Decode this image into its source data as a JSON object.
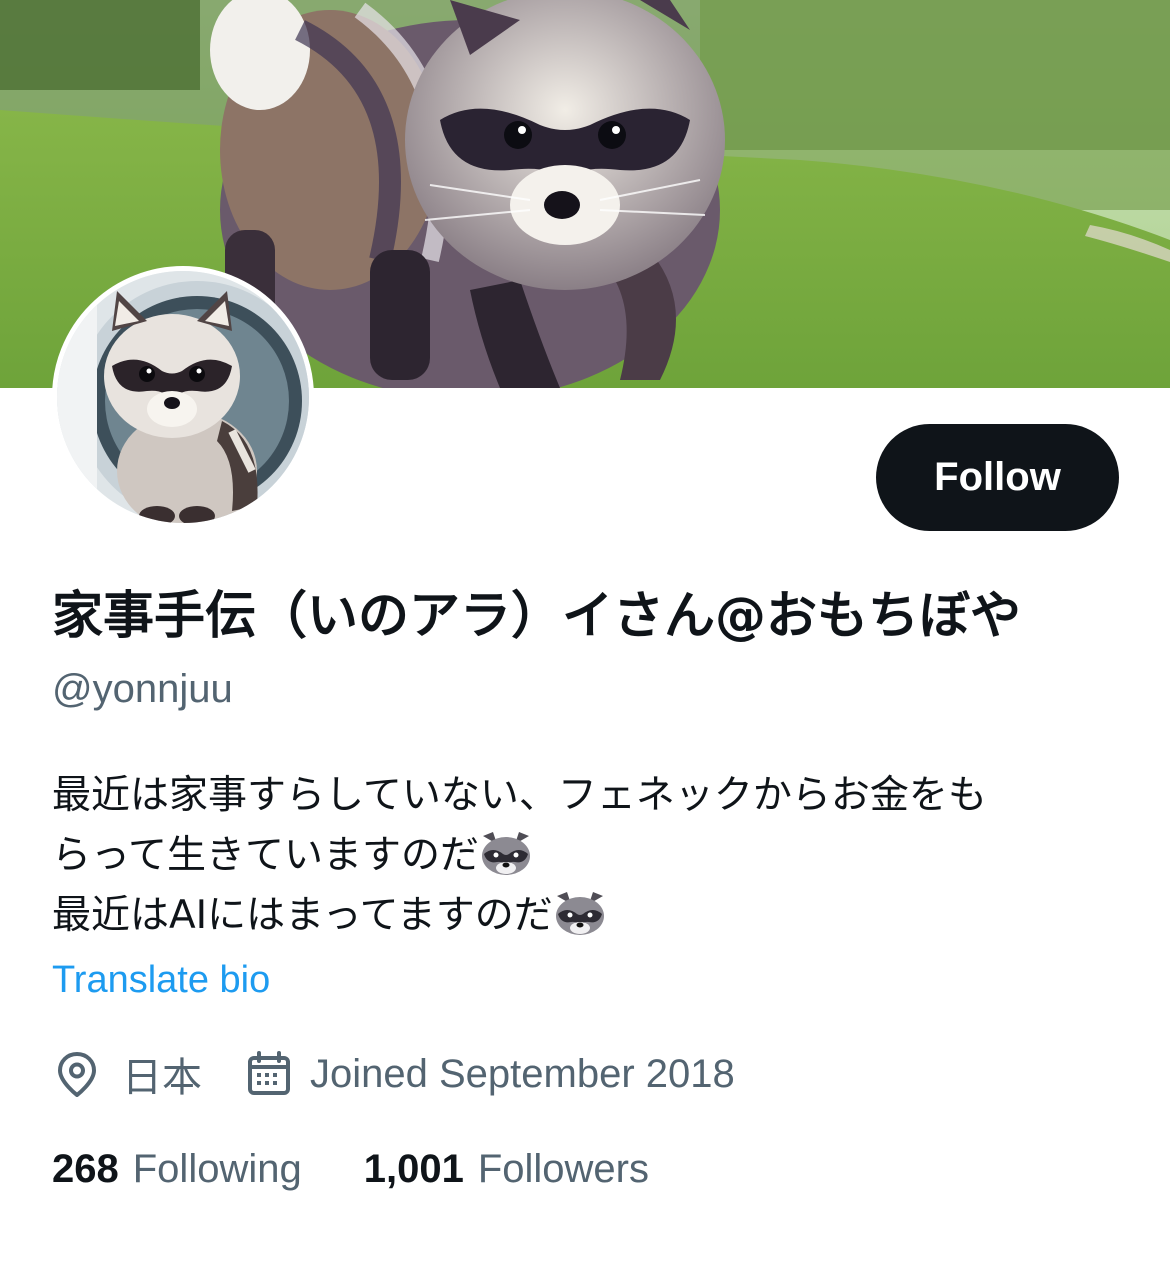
{
  "profile": {
    "display_name": "家事手伝（いのアラ）イさん@おもちぼや",
    "handle": "@yonnjuu",
    "bio_lines": [
      "最近は家事すらしていない、フェネックからお金をも",
      "らって生きていますのだ",
      "最近はAIにはまってますのだ"
    ],
    "bio_emoji": "raccoon-emoji",
    "translate_label": "Translate bio",
    "location": "日本",
    "joined": "Joined September 2018"
  },
  "actions": {
    "follow_label": "Follow"
  },
  "stats": {
    "following_count": "268",
    "following_label": "Following",
    "followers_count": "1,001",
    "followers_label": "Followers"
  },
  "icons": {
    "location": "location-pin-icon",
    "calendar": "calendar-icon"
  },
  "colors": {
    "text_primary": "#0f1419",
    "text_secondary": "#536471",
    "link": "#1d9bf0",
    "button_bg": "#0f1419",
    "button_text": "#ffffff"
  }
}
